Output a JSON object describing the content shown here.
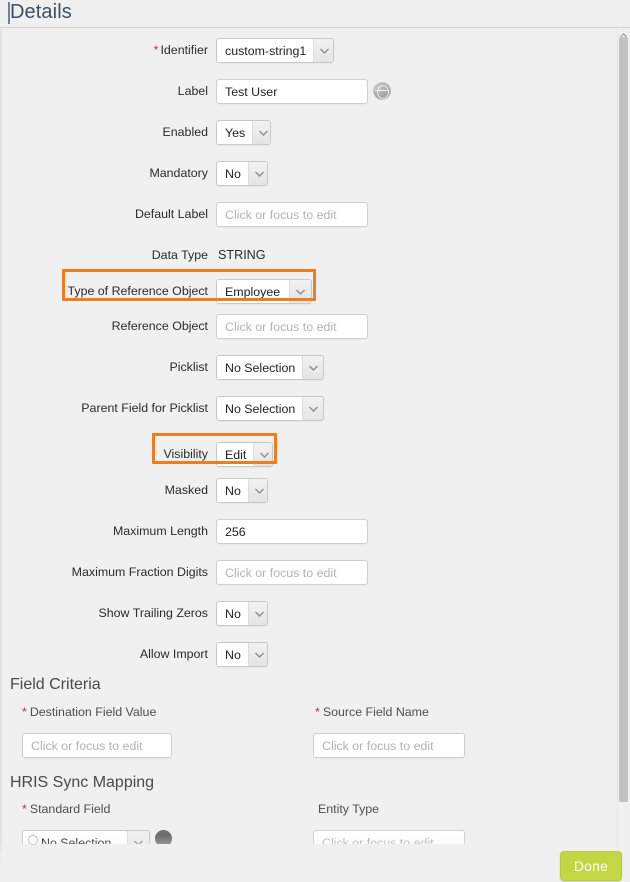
{
  "header": {
    "title": "Details"
  },
  "details": {
    "rows": [
      {
        "label": "Identifier",
        "required": true,
        "type": "combo",
        "value": "custom-string1"
      },
      {
        "label": "Label",
        "required": false,
        "type": "input",
        "value": "Test User",
        "placeholder": "",
        "helper_icon": "globe-icon"
      },
      {
        "label": "Enabled",
        "required": false,
        "type": "combo",
        "value": "Yes"
      },
      {
        "label": "Mandatory",
        "required": false,
        "type": "combo",
        "value": "No"
      },
      {
        "label": "Default Label",
        "required": false,
        "type": "input",
        "value": "",
        "placeholder": "Click or focus to edit"
      },
      {
        "label": "Data Type",
        "required": false,
        "type": "static",
        "value": "STRING"
      },
      {
        "label": "Type of Reference Object",
        "required": false,
        "type": "combo",
        "value": "Employee",
        "highlighted": true
      },
      {
        "label": "Reference Object",
        "required": false,
        "type": "input",
        "value": "",
        "placeholder": "Click or focus to edit"
      },
      {
        "label": "Picklist",
        "required": false,
        "type": "combo",
        "value": "No Selection"
      },
      {
        "label": "Parent Field for Picklist",
        "required": false,
        "type": "combo",
        "value": "No Selection"
      },
      {
        "label": "Visibility",
        "required": false,
        "type": "combo",
        "value": "Edit",
        "highlighted": true
      },
      {
        "label": "Masked",
        "required": false,
        "type": "combo",
        "value": "No"
      },
      {
        "label": "Maximum Length",
        "required": false,
        "type": "input",
        "value": "256",
        "placeholder": ""
      },
      {
        "label": "Maximum Fraction Digits",
        "required": false,
        "type": "input",
        "value": "",
        "placeholder": "Click or focus to edit"
      },
      {
        "label": "Show Trailing Zeros",
        "required": false,
        "type": "combo",
        "value": "No"
      },
      {
        "label": "Allow Import",
        "required": false,
        "type": "combo",
        "value": "No"
      }
    ]
  },
  "field_criteria": {
    "heading": "Field Criteria",
    "destination_field_value": {
      "label": "Destination Field Value",
      "required": true,
      "placeholder": "Click or focus to edit",
      "value": ""
    },
    "source_field_name": {
      "label": "Source Field Name",
      "required": true,
      "placeholder": "Click or focus to edit",
      "value": ""
    }
  },
  "hris_sync_mapping": {
    "heading": "HRIS Sync Mapping",
    "standard_field": {
      "label": "Standard Field",
      "required": true,
      "value": "No Selection"
    },
    "entity_type": {
      "label": "Entity Type",
      "required": false,
      "placeholder": "Click or focus to edit",
      "value": ""
    }
  },
  "footer": {
    "done_label": "Done"
  },
  "colors": {
    "highlight": "#ed7d1f",
    "done_button": "#c3d644",
    "header_text": "#3b5063",
    "required_asterisk": "#b03a3a",
    "panel_bg": "#f0f0f0"
  }
}
